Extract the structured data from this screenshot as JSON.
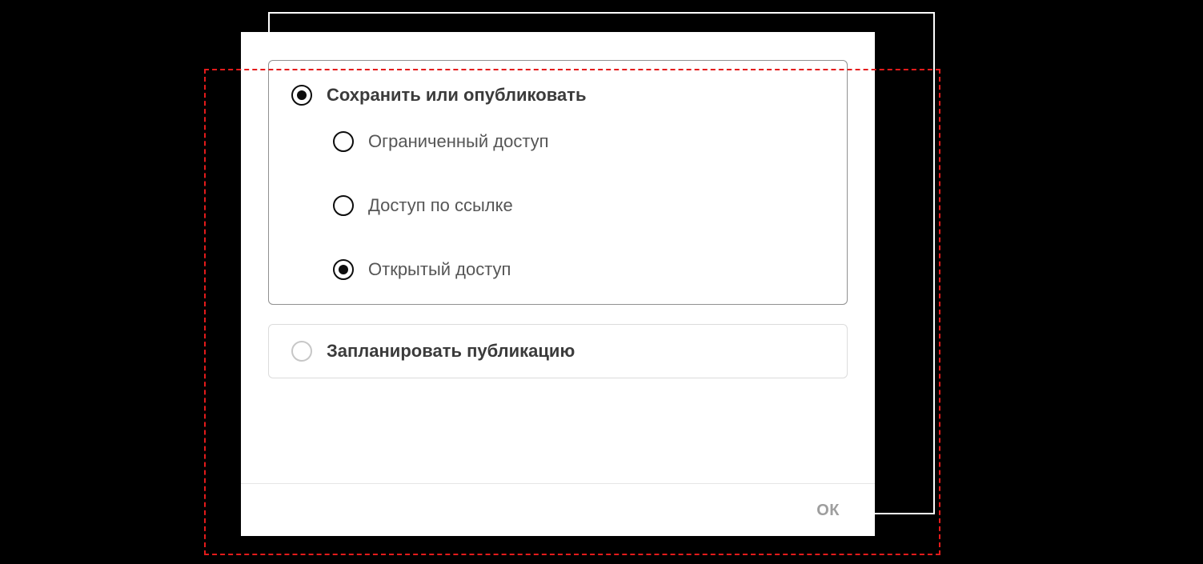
{
  "main_option": {
    "label": "Сохранить или опубликовать",
    "selected": true,
    "sub_options": [
      {
        "label": "Ограниченный доступ",
        "selected": false
      },
      {
        "label": "Доступ по ссылке",
        "selected": false
      },
      {
        "label": "Открытый доступ",
        "selected": true
      }
    ]
  },
  "schedule_option": {
    "label": "Запланировать публикацию",
    "selected": false
  },
  "footer": {
    "ok_label": "ОК"
  }
}
